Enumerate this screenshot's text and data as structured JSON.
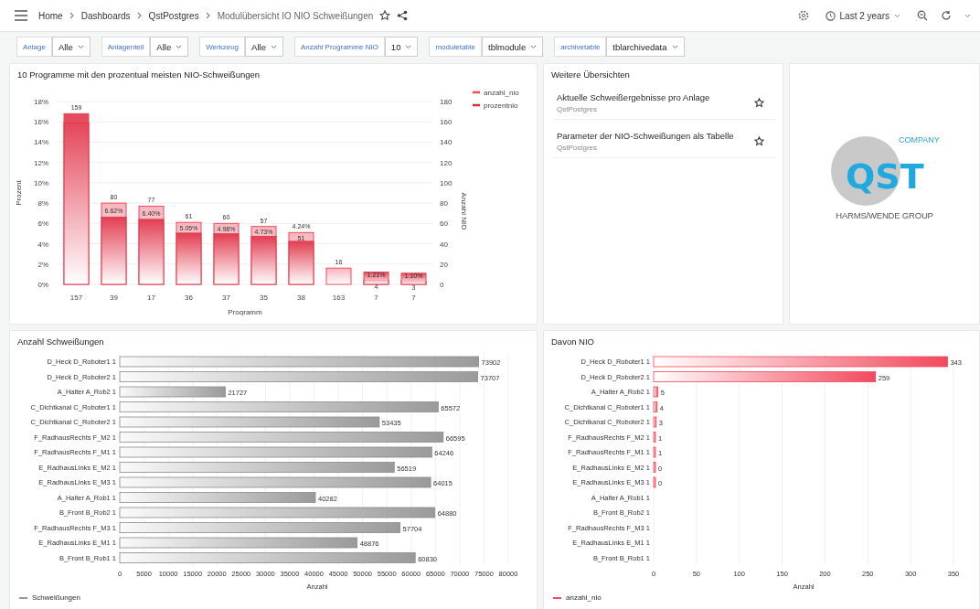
{
  "topbar": {
    "breadcrumbs": [
      "Home",
      "Dashboards",
      "QstPostgres",
      "Modulübersicht IO NIO Schweißungen"
    ],
    "time_range": "Last 2 years"
  },
  "variables": [
    {
      "label": "Anlage",
      "value": "Alle"
    },
    {
      "label": "Anlagenteil",
      "value": "Alle"
    },
    {
      "label": "Werkzeug",
      "value": "Alle"
    },
    {
      "label": "Anzahl Programme NIO",
      "value": "10"
    },
    {
      "label": "moduletable",
      "value": "tblmodule"
    },
    {
      "label": "archivetable",
      "value": "tblarchivedata"
    }
  ],
  "top_chart": {
    "title": "10 Programme mit den prozentual meisten NIO-Schweißungen",
    "chart_data": {
      "type": "bar",
      "grid": true,
      "legend": "right",
      "xlabel": "Programm",
      "ylabel": "Prozent",
      "y2label": "Anzahl NIO",
      "categories": [
        "157",
        "39",
        "17",
        "36",
        "37",
        "35",
        "38",
        "163",
        "7",
        "7"
      ],
      "ylim": [
        0,
        18
      ],
      "y2lim": [
        0,
        180
      ],
      "yticks": [
        {
          "value": 0,
          "label": "0%"
        },
        {
          "value": 2,
          "label": "2%"
        },
        {
          "value": 4,
          "label": "4%"
        },
        {
          "value": 6,
          "label": "6%"
        },
        {
          "value": 8,
          "label": "8%"
        },
        {
          "value": 10,
          "label": "10%"
        },
        {
          "value": 12,
          "label": "12%"
        },
        {
          "value": 14,
          "label": "14%"
        },
        {
          "value": 16,
          "label": "16%"
        },
        {
          "value": 18,
          "label": "18%"
        }
      ],
      "y2ticks": [
        0,
        20,
        40,
        60,
        80,
        100,
        120,
        140,
        160,
        180
      ],
      "series": [
        {
          "name": "anzahl_nio",
          "color": "#f2495c",
          "axis": "y2",
          "values": [
            159,
            80,
            77,
            61,
            60,
            57,
            51,
            16,
            4,
            3
          ],
          "value_labels": [
            "159",
            "80",
            "77",
            "61",
            "60",
            "57",
            "51",
            "16",
            "4",
            "3"
          ]
        },
        {
          "name": "prozentnio",
          "color": "#e0283e",
          "values": [
            16.8,
            6.62,
            6.4,
            5.05,
            4.98,
            4.73,
            4.24,
            null,
            1.21,
            1.1
          ],
          "value_labels": [
            null,
            "6.62%",
            "6.40%",
            "5.05%",
            "4.98%",
            "4.73%",
            "4.24%",
            null,
            "1.21%",
            "1.10%"
          ]
        }
      ]
    }
  },
  "overviews": {
    "title": "Weitere Übersichten",
    "items": [
      {
        "title": "Aktuelle Schweißergebnisse pro Anlage",
        "source": "QstPostgres"
      },
      {
        "title": "Parameter der NIO-Schweißungen als Tabelle",
        "source": "QstPostgres"
      }
    ]
  },
  "logo": {
    "mark": "QST",
    "tagline": "COMPANY",
    "group": "HARMS/WENDE GROUP"
  },
  "welds_chart": {
    "title": "Anzahl Schweißungen",
    "chart_data": {
      "type": "bar",
      "orientation": "horizontal",
      "grid": true,
      "xlabel": "Anzahl",
      "xlim": [
        0,
        80000
      ],
      "xticks": [
        0,
        5000,
        10000,
        15000,
        20000,
        25000,
        30000,
        35000,
        40000,
        45000,
        50000,
        55000,
        60000,
        65000,
        70000,
        75000,
        80000
      ],
      "data_labels": true,
      "categories": [
        "D_Heck D_Roboter1 1",
        "D_Heck D_Roboter2 1",
        "A_Halter A_Rob2 1",
        "C_Dichtkanal C_Roboter1 1",
        "C_Dichtkanal C_Roboter2 1",
        "F_RadhausRechts F_M2 1",
        "F_RadhausRechts F_M1 1",
        "E_RadhausLinks E_M2 1",
        "E_RadhausLinks E_M3 1",
        "A_Halter A_Rob1 1",
        "B_Front B_Rob2 1",
        "F_RadhausRechts F_M3 1",
        "E_RadhausLinks E_M1 1",
        "B_Front B_Rob1 1"
      ],
      "series": [
        {
          "name": "Schweißungen",
          "color": "#9a9a9a",
          "values": [
            73902,
            73707,
            21727,
            65572,
            53435,
            66595,
            64246,
            56519,
            64015,
            40282,
            64880,
            57704,
            48876,
            60830
          ]
        }
      ]
    }
  },
  "nio_chart": {
    "title": "Davon NIO",
    "chart_data": {
      "type": "bar",
      "orientation": "horizontal",
      "grid": true,
      "xlabel": "Anzahl",
      "xlim": [
        0,
        350
      ],
      "xticks": [
        0,
        50,
        100,
        150,
        200,
        250,
        300,
        350
      ],
      "data_labels": true,
      "categories": [
        "D_Heck D_Roboter1 1",
        "D_Heck D_Roboter2 1",
        "A_Halter A_Rob2 1",
        "C_Dichtkanal C_Roboter1 1",
        "C_Dichtkanal C_Roboter2 1",
        "F_RadhausRechts F_M2 1",
        "F_RadhausRechts F_M1 1",
        "E_RadhausLinks E_M2 1",
        "E_RadhausLinks E_M3 1",
        "A_Halter A_Rob1 1",
        "B_Front B_Rob2 1",
        "F_RadhausRechts F_M3 1",
        "E_RadhausLinks E_M1 1",
        "B_Front B_Rob1 1"
      ],
      "series": [
        {
          "name": "anzahl_nio",
          "color": "#f2495c",
          "values": [
            343,
            259,
            5,
            4,
            3,
            1,
            1,
            0,
            0,
            null,
            null,
            null,
            null,
            null
          ]
        }
      ]
    }
  }
}
